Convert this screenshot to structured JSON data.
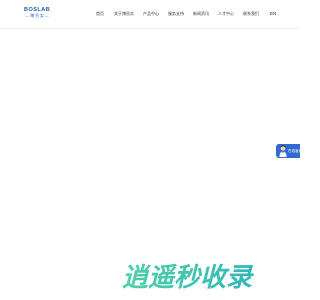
{
  "header": {
    "logo": {
      "name": "BOSLAB",
      "subtitle": "— 博 岳 实 —"
    },
    "nav": [
      {
        "label": "首页"
      },
      {
        "label": "关于博岳实"
      },
      {
        "label": "产品中心"
      },
      {
        "label": "服务支持"
      },
      {
        "label": "新闻资讯"
      },
      {
        "label": "人才中心"
      },
      {
        "label": "联系我们"
      }
    ],
    "language": "EN"
  },
  "floating_service": {
    "label": "在线客服"
  },
  "watermark": {
    "text": "逍遥秒收录"
  },
  "colors": {
    "brand": "#1e5db5",
    "float_button": "#2f6bd3",
    "watermark": "#3ec4a8"
  }
}
